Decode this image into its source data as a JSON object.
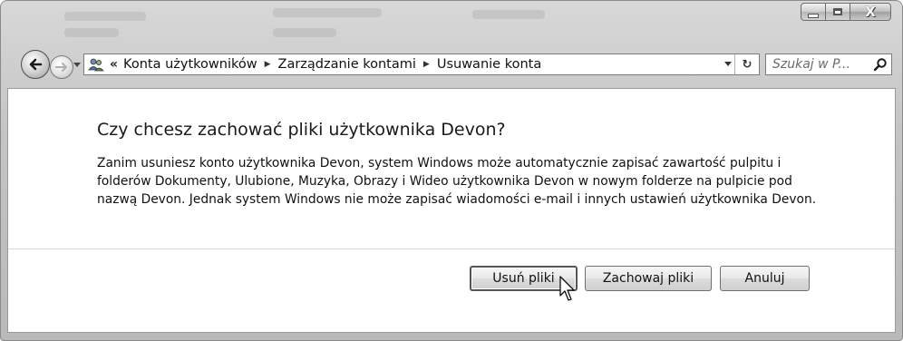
{
  "window": {
    "controls": {
      "minimize_icon": "minimize-icon",
      "maximize_icon": "maximize-icon",
      "close_icon": "close-icon",
      "close_glyph": "X"
    }
  },
  "navigation": {
    "back_icon": "back-arrow-icon",
    "forward_icon": "forward-arrow-icon",
    "address": {
      "location_icon": "user-accounts-icon",
      "overflow": "«",
      "breadcrumbs": [
        "Konta użytkowników",
        "Zarządzanie kontami",
        "Usuwanie konta"
      ],
      "separator": "▶",
      "refresh_glyph": "↻"
    },
    "search": {
      "placeholder": "Szukaj w P..."
    }
  },
  "dialog": {
    "title": "Czy chcesz zachować pliki użytkownika Devon?",
    "description": "Zanim usuniesz konto użytkownika Devon, system Windows może automatycznie zapisać zawartość pulpitu i folderów Dokumenty, Ulubione, Muzyka, Obrazy i Wideo użytkownika Devon w nowym folderze na pulpicie pod nazwą Devon. Jednak system Windows nie może zapisać wiadomości e-mail i innych ustawień użytkownika Devon.",
    "buttons": {
      "delete_files": "Usuń pliki",
      "keep_files": "Zachowaj pliki",
      "cancel": "Anuluj"
    }
  },
  "colors": {
    "chrome": "#c4c4c4",
    "content_background": "#ffffff",
    "text": "#111111"
  }
}
